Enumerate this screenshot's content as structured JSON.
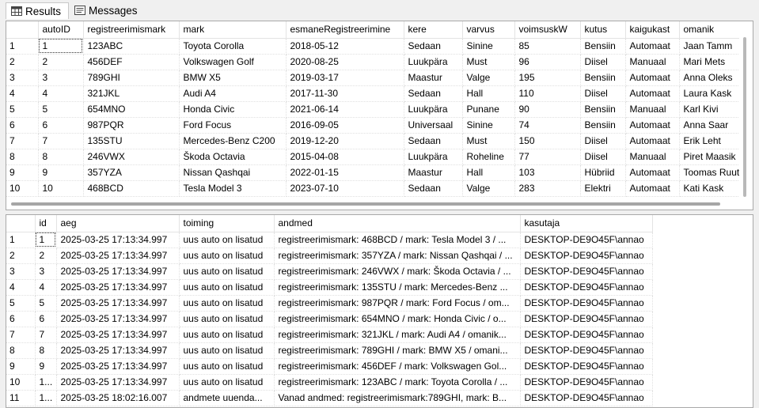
{
  "tabs": {
    "results": "Results",
    "messages": "Messages"
  },
  "grid1": {
    "columns": [
      "autoID",
      "registreerimismark",
      "mark",
      "esmaneRegistreerimine",
      "kere",
      "varvus",
      "voimsuskW",
      "kutus",
      "kaigukast",
      "omanik"
    ],
    "rows": [
      [
        "1",
        "1",
        "123ABC",
        "Toyota Corolla",
        "2018-05-12",
        "Sedaan",
        "Sinine",
        "85",
        "Bensiin",
        "Automaat",
        "Jaan Tamm"
      ],
      [
        "2",
        "2",
        "456DEF",
        "Volkswagen Golf",
        "2020-08-25",
        "Luukpära",
        "Must",
        "96",
        "Diisel",
        "Manuaal",
        "Mari Mets"
      ],
      [
        "3",
        "3",
        "789GHI",
        "BMW X5",
        "2019-03-17",
        "Maastur",
        "Valge",
        "195",
        "Bensiin",
        "Automaat",
        "Anna Oleks"
      ],
      [
        "4",
        "4",
        "321JKL",
        "Audi A4",
        "2017-11-30",
        "Sedaan",
        "Hall",
        "110",
        "Diisel",
        "Automaat",
        "Laura Kask"
      ],
      [
        "5",
        "5",
        "654MNO",
        "Honda Civic",
        "2021-06-14",
        "Luukpära",
        "Punane",
        "90",
        "Bensiin",
        "Manuaal",
        "Karl Kivi"
      ],
      [
        "6",
        "6",
        "987PQR",
        "Ford Focus",
        "2016-09-05",
        "Universaal",
        "Sinine",
        "74",
        "Bensiin",
        "Automaat",
        "Anna Saar"
      ],
      [
        "7",
        "7",
        "135STU",
        "Mercedes-Benz C200",
        "2019-12-20",
        "Sedaan",
        "Must",
        "150",
        "Diisel",
        "Automaat",
        "Erik Leht"
      ],
      [
        "8",
        "8",
        "246VWX",
        "Škoda Octavia",
        "2015-04-08",
        "Luukpära",
        "Roheline",
        "77",
        "Diisel",
        "Manuaal",
        "Piret Maasik"
      ],
      [
        "9",
        "9",
        "357YZA",
        "Nissan Qashqai",
        "2022-01-15",
        "Maastur",
        "Hall",
        "103",
        "Hübriid",
        "Automaat",
        "Toomas Ruut"
      ],
      [
        "10",
        "10",
        "468BCD",
        "Tesla Model 3",
        "2023-07-10",
        "Sedaan",
        "Valge",
        "283",
        "Elektri",
        "Automaat",
        "Kati Kask"
      ]
    ]
  },
  "grid2": {
    "columns": [
      "id",
      "aeg",
      "toiming",
      "andmed",
      "kasutaja"
    ],
    "rows": [
      [
        "1",
        "1",
        "2025-03-25 17:13:34.997",
        "uus auto on lisatud",
        "registreerimismark: 468BCD / mark: Tesla Model 3 / ...",
        "DESKTOP-DE9O45F\\annao"
      ],
      [
        "2",
        "2",
        "2025-03-25 17:13:34.997",
        "uus auto on lisatud",
        "registreerimismark: 357YZA / mark: Nissan Qashqai / ...",
        "DESKTOP-DE9O45F\\annao"
      ],
      [
        "3",
        "3",
        "2025-03-25 17:13:34.997",
        "uus auto on lisatud",
        "registreerimismark: 246VWX / mark: Škoda Octavia / ...",
        "DESKTOP-DE9O45F\\annao"
      ],
      [
        "4",
        "4",
        "2025-03-25 17:13:34.997",
        "uus auto on lisatud",
        "registreerimismark: 135STU / mark: Mercedes-Benz ...",
        "DESKTOP-DE9O45F\\annao"
      ],
      [
        "5",
        "5",
        "2025-03-25 17:13:34.997",
        "uus auto on lisatud",
        "registreerimismark: 987PQR / mark: Ford Focus / om...",
        "DESKTOP-DE9O45F\\annao"
      ],
      [
        "6",
        "6",
        "2025-03-25 17:13:34.997",
        "uus auto on lisatud",
        "registreerimismark: 654MNO / mark: Honda Civic / o...",
        "DESKTOP-DE9O45F\\annao"
      ],
      [
        "7",
        "7",
        "2025-03-25 17:13:34.997",
        "uus auto on lisatud",
        "registreerimismark: 321JKL / mark: Audi A4 / omanik...",
        "DESKTOP-DE9O45F\\annao"
      ],
      [
        "8",
        "8",
        "2025-03-25 17:13:34.997",
        "uus auto on lisatud",
        "registreerimismark: 789GHI / mark: BMW X5 / omani...",
        "DESKTOP-DE9O45F\\annao"
      ],
      [
        "9",
        "9",
        "2025-03-25 17:13:34.997",
        "uus auto on lisatud",
        "registreerimismark: 456DEF / mark: Volkswagen Gol...",
        "DESKTOP-DE9O45F\\annao"
      ],
      [
        "10",
        "1...",
        "2025-03-25 17:13:34.997",
        "uus auto on lisatud",
        "registreerimismark: 123ABC / mark: Toyota Corolla / ...",
        "DESKTOP-DE9O45F\\annao"
      ],
      [
        "11",
        "1...",
        "2025-03-25 18:02:16.007",
        "andmete uuenda...",
        "Vanad andmed: registreerimismark:789GHI, mark: B...",
        "DESKTOP-DE9O45F\\annao"
      ]
    ]
  }
}
